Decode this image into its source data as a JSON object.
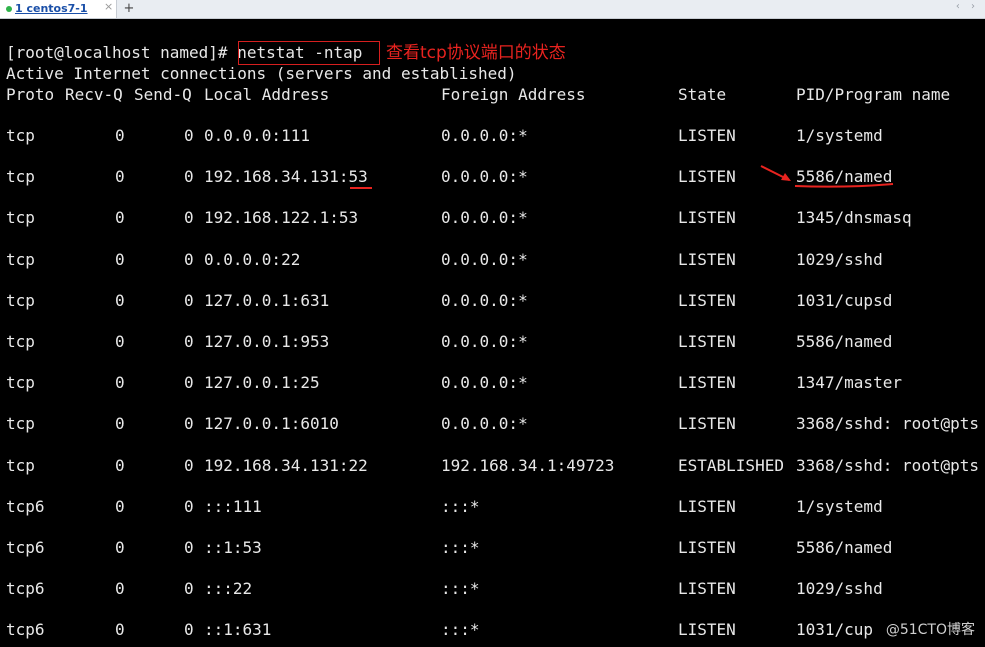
{
  "tabbar": {
    "tab_label": "1 centos7-1",
    "close_glyph": "×",
    "new_tab_glyph": "+",
    "nav_glyphs": "‹ ›"
  },
  "terminal": {
    "prompt": "[root@localhost named]# ",
    "command": "netstat -ntap",
    "annotation": "查看tcp协议端口的状态",
    "info_line": "Active Internet connections (servers and established)",
    "headers": {
      "proto": "Proto",
      "recvq": "Recv-Q",
      "sendq": "Send-Q",
      "local": "Local Address",
      "foreign": "Foreign Address",
      "state": "State",
      "pid": "PID/Program name"
    },
    "rows": [
      {
        "proto": "tcp",
        "recv": "0",
        "send": "0",
        "local": "0.0.0.0:111",
        "foreign": "0.0.0.0:*",
        "state": "LISTEN",
        "pid": "1/systemd"
      },
      {
        "proto": "tcp",
        "recv": "0",
        "send": "0",
        "local": "192.168.34.131:53",
        "foreign": "0.0.0.0:*",
        "state": "LISTEN",
        "pid": "5586/named"
      },
      {
        "proto": "tcp",
        "recv": "0",
        "send": "0",
        "local": "192.168.122.1:53",
        "foreign": "0.0.0.0:*",
        "state": "LISTEN",
        "pid": "1345/dnsmasq"
      },
      {
        "proto": "tcp",
        "recv": "0",
        "send": "0",
        "local": "0.0.0.0:22",
        "foreign": "0.0.0.0:*",
        "state": "LISTEN",
        "pid": "1029/sshd"
      },
      {
        "proto": "tcp",
        "recv": "0",
        "send": "0",
        "local": "127.0.0.1:631",
        "foreign": "0.0.0.0:*",
        "state": "LISTEN",
        "pid": "1031/cupsd"
      },
      {
        "proto": "tcp",
        "recv": "0",
        "send": "0",
        "local": "127.0.0.1:953",
        "foreign": "0.0.0.0:*",
        "state": "LISTEN",
        "pid": "5586/named"
      },
      {
        "proto": "tcp",
        "recv": "0",
        "send": "0",
        "local": "127.0.0.1:25",
        "foreign": "0.0.0.0:*",
        "state": "LISTEN",
        "pid": "1347/master"
      },
      {
        "proto": "tcp",
        "recv": "0",
        "send": "0",
        "local": "127.0.0.1:6010",
        "foreign": "0.0.0.0:*",
        "state": "LISTEN",
        "pid": "3368/sshd: root@pts"
      },
      {
        "proto": "tcp",
        "recv": "0",
        "send": "0",
        "local": "192.168.34.131:22",
        "foreign": "192.168.34.1:49723",
        "state": "ESTABLISHED",
        "pid": "3368/sshd: root@pts"
      },
      {
        "proto": "tcp6",
        "recv": "0",
        "send": "0",
        "local": ":::111",
        "foreign": ":::*",
        "state": "LISTEN",
        "pid": "1/systemd"
      },
      {
        "proto": "tcp6",
        "recv": "0",
        "send": "0",
        "local": "::1:53",
        "foreign": ":::*",
        "state": "LISTEN",
        "pid": "5586/named"
      },
      {
        "proto": "tcp6",
        "recv": "0",
        "send": "0",
        "local": ":::22",
        "foreign": ":::*",
        "state": "LISTEN",
        "pid": "1029/sshd"
      },
      {
        "proto": "tcp6",
        "recv": "0",
        "send": "0",
        "local": "::1:631",
        "foreign": ":::*",
        "state": "LISTEN",
        "pid": "1031/cup"
      }
    ]
  },
  "watermark": "@51CTO博客",
  "colors": {
    "annotation_red": "#e8231f",
    "terminal_bg": "#000000",
    "terminal_fg": "#e8e8e8"
  }
}
